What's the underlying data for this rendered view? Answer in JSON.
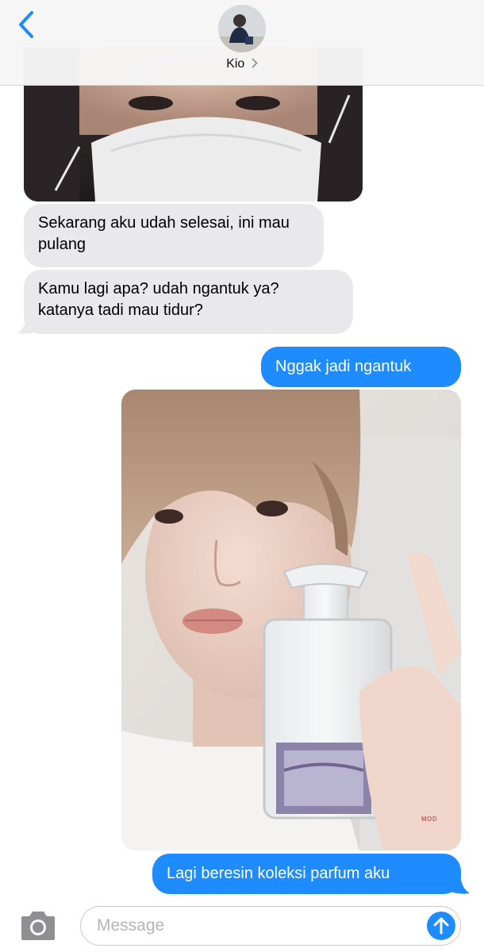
{
  "header": {
    "contact_name": "Kio",
    "back_icon": "chevron-left-icon",
    "name_chevron_icon": "chevron-right-icon"
  },
  "messages": [
    {
      "type": "image",
      "direction": "received",
      "description": "photo"
    },
    {
      "type": "text",
      "direction": "received",
      "text": "Sekarang aku udah selesai, ini mau pulang"
    },
    {
      "type": "text",
      "direction": "received",
      "text": "Kamu lagi apa? udah ngantuk ya? katanya tadi mau tidur?"
    },
    {
      "type": "text",
      "direction": "sent",
      "text": "Nggak jadi ngantuk"
    },
    {
      "type": "image",
      "direction": "sent",
      "description": "photo",
      "watermark": "MOD"
    },
    {
      "type": "text",
      "direction": "sent",
      "text": "Lagi beresin koleksi parfum aku"
    }
  ],
  "compose": {
    "placeholder": "Message",
    "value": "",
    "camera_icon": "camera-icon",
    "send_icon": "arrow-up-icon"
  },
  "colors": {
    "sent_bubble": "#1e8bff",
    "received_bubble": "#e9e9eb",
    "accent": "#1e8bff"
  }
}
